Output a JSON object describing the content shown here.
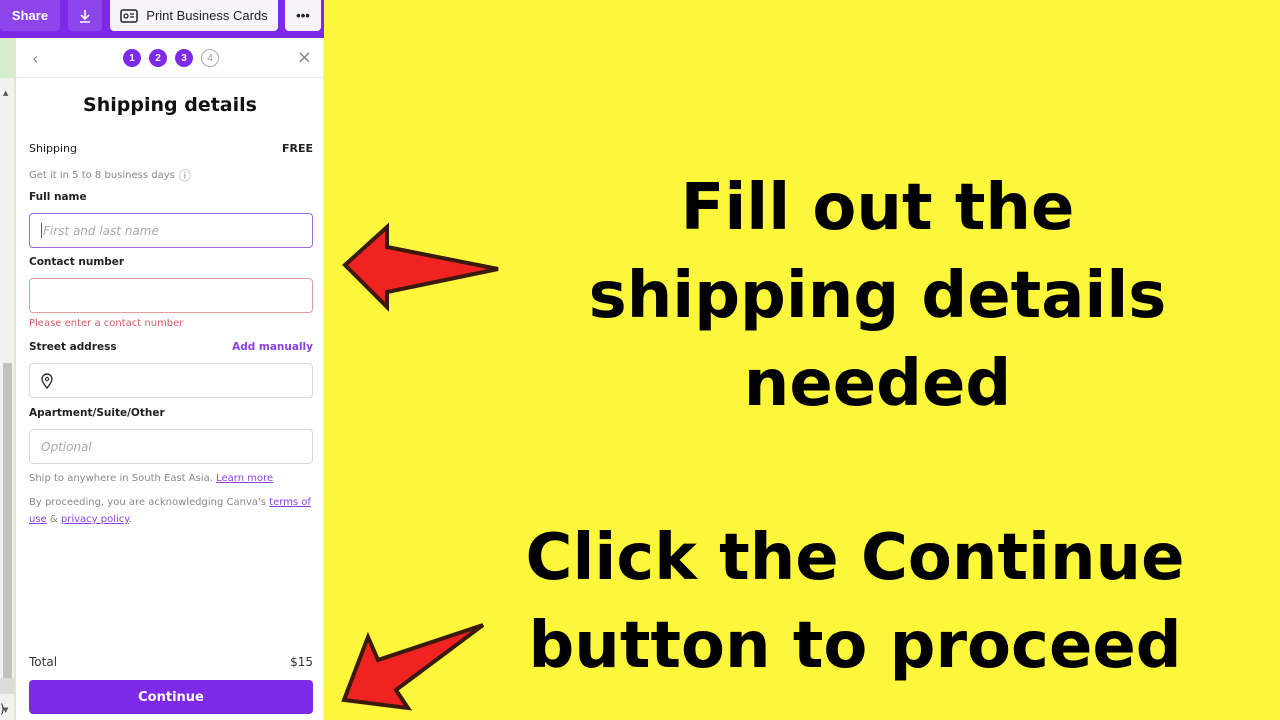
{
  "toolbar": {
    "share_label": "Share",
    "download_icon": "download-icon",
    "print_label": "Print Business Cards",
    "print_icon": "business-card-icon",
    "more_label": "•••"
  },
  "stepper": {
    "back_icon": "‹",
    "close_icon": "×",
    "steps": [
      "1",
      "2",
      "3",
      "4"
    ],
    "current_step": 3
  },
  "form": {
    "title": "Shipping details",
    "shipping_label": "Shipping",
    "shipping_value": "FREE",
    "delivery_note": "Get it in 5 to 8 business days",
    "info_icon": "ⓘ",
    "full_name_label": "Full name",
    "full_name_placeholder": "First and last name",
    "full_name_value": "",
    "contact_label": "Contact number",
    "contact_value": "",
    "contact_error": "Please enter a contact number",
    "street_label": "Street address",
    "add_manually_label": "Add manually",
    "street_value": "",
    "apartment_label": "Apartment/Suite/Other",
    "apartment_placeholder": "Optional",
    "ship_note": "Ship to anywhere in South East Asia.",
    "learn_more_label": "Learn more",
    "legal_prefix": "By proceeding, you are acknowledging Canva's",
    "terms_label": "terms of use",
    "legal_and": "&",
    "privacy_label": "privacy policy",
    "legal_suffix": ".",
    "total_label": "Total",
    "total_value": "$15",
    "continue_label": "Continue"
  },
  "annotations": {
    "top": "Fill out the shipping details needed",
    "bottom": "Click the Continue button to proceed"
  },
  "colors": {
    "brand_purple": "#7d2ae8",
    "background_yellow": "#fdf73b",
    "arrow_red": "#f02020",
    "error_red": "#d65a6a"
  }
}
